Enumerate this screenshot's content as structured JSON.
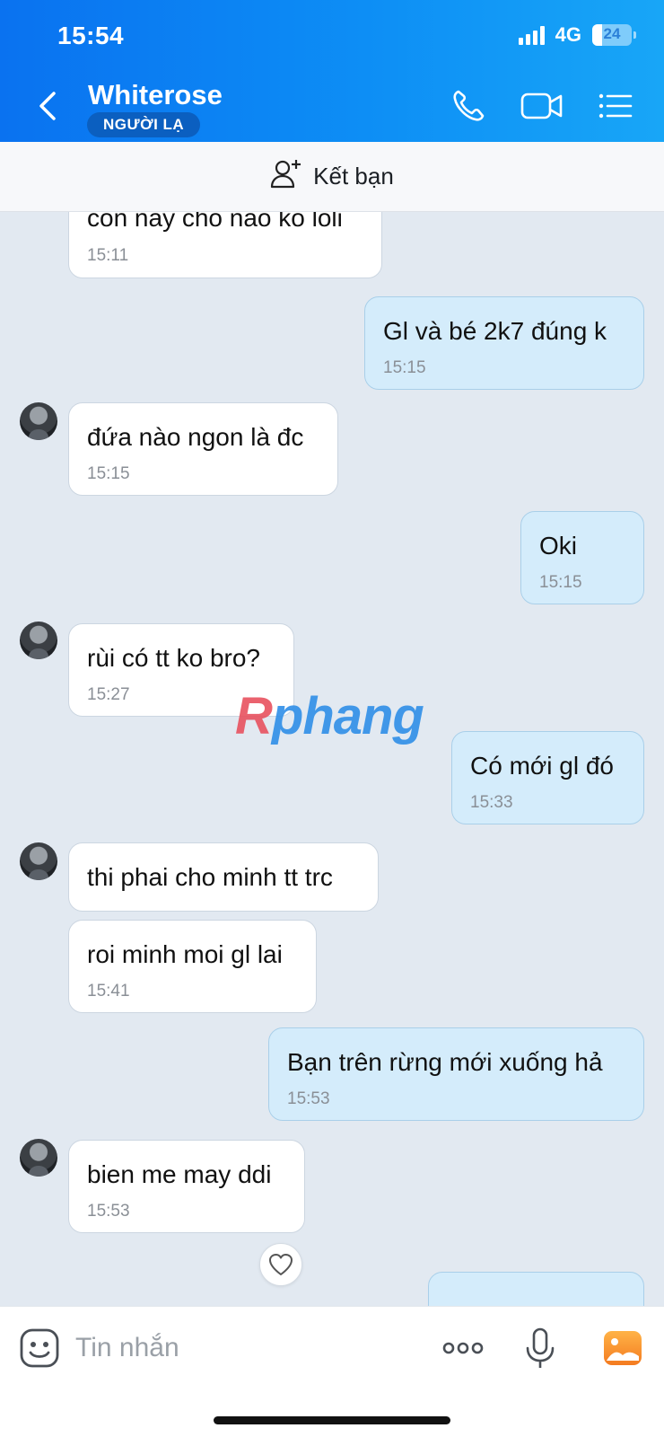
{
  "status_bar": {
    "time": "15:54",
    "network": "4G",
    "battery": "24",
    "battery_fraction": 0.24
  },
  "header": {
    "contact_name": "Whiterose",
    "badge": "NGƯỜI LẠ",
    "icons": [
      "back-icon",
      "phone-icon",
      "video-call-icon",
      "menu-list-icon"
    ]
  },
  "add_friend": {
    "label": "Kết bạn",
    "icon": "add-user-icon"
  },
  "messages": [
    {
      "side": "in",
      "text": "con nay cho nao ko loli",
      "time": "15:11"
    },
    {
      "side": "out",
      "text": "Gl và bé 2k7 đúng k",
      "time": "15:15"
    },
    {
      "side": "in",
      "text": "đứa nào ngon là đc",
      "time": "15:15"
    },
    {
      "side": "out",
      "text": "Oki",
      "time": "15:15"
    },
    {
      "side": "in",
      "text": "rùi có tt ko bro?",
      "time": "15:27"
    },
    {
      "side": "out",
      "text": "Có mới gl đó",
      "time": "15:33"
    },
    {
      "side": "in",
      "text": "thi phai cho minh tt trc",
      "time": ""
    },
    {
      "side": "in",
      "text": "roi minh moi gl lai",
      "time": "15:41"
    },
    {
      "side": "out",
      "text": "Bạn trên rừng mới xuống hả",
      "time": "15:53"
    },
    {
      "side": "in",
      "text": "bien me may ddi",
      "time": "15:53"
    }
  ],
  "watermark": {
    "first": "R",
    "rest": "phang"
  },
  "composer": {
    "placeholder": "Tin nhắn",
    "icons": [
      "sticker-icon",
      "more-icon",
      "microphone-icon",
      "gallery-icon"
    ]
  },
  "colors": {
    "header_start": "#0a72f0",
    "header_end": "#18a6f7",
    "chat_bg": "#e2e9f1",
    "outgoing_bubble": "#d4ecfb",
    "incoming_bubble": "#ffffff"
  }
}
